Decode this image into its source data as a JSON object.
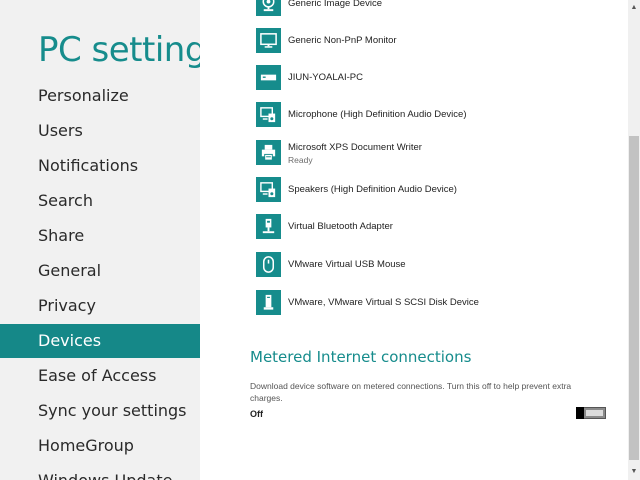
{
  "nav": {
    "title": "PC settings",
    "items": [
      {
        "label": "Personalize"
      },
      {
        "label": "Users"
      },
      {
        "label": "Notifications"
      },
      {
        "label": "Search"
      },
      {
        "label": "Share"
      },
      {
        "label": "General"
      },
      {
        "label": "Privacy"
      },
      {
        "label": "Devices",
        "active": true
      },
      {
        "label": "Ease of Access"
      },
      {
        "label": "Sync your settings"
      },
      {
        "label": "HomeGroup"
      },
      {
        "label": "Windows Update"
      }
    ]
  },
  "devices": [
    {
      "name": "Generic Image Device",
      "icon": "webcam-icon"
    },
    {
      "name": "Generic Non-PnP Monitor",
      "icon": "monitor-icon"
    },
    {
      "name": "JIUN-YOALAI-PC",
      "icon": "computer-icon"
    },
    {
      "name": "Microphone (High Definition Audio Device)",
      "icon": "audio-device-icon"
    },
    {
      "name": "Microsoft XPS Document Writer",
      "status": "Ready",
      "icon": "printer-icon"
    },
    {
      "name": "Speakers (High Definition Audio Device)",
      "icon": "audio-device-icon"
    },
    {
      "name": "Virtual Bluetooth Adapter",
      "icon": "usb-adapter-icon"
    },
    {
      "name": "VMware Virtual USB Mouse",
      "icon": "mouse-icon"
    },
    {
      "name": "VMware, VMware Virtual S SCSI Disk Device",
      "icon": "disk-drive-icon"
    }
  ],
  "metered": {
    "title": "Metered Internet connections",
    "description": "Download device software on metered connections. Turn this off to help prevent extra charges.",
    "toggle_label": "Off",
    "enabled": false
  },
  "colors": {
    "accent": "#168c8c",
    "nav_background": "#f1f1f1",
    "active_background": "#158888"
  }
}
